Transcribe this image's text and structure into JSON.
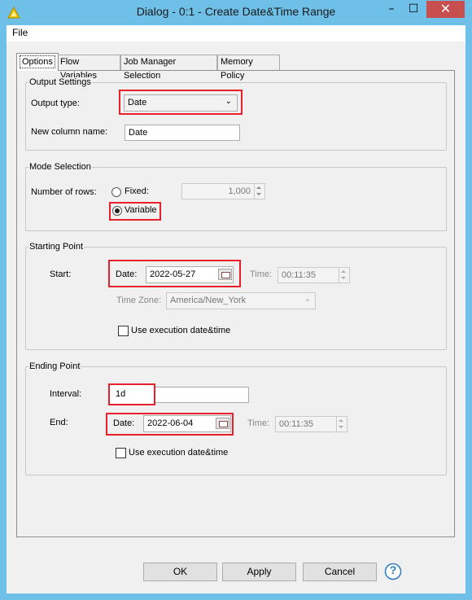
{
  "window": {
    "title": "Dialog - 0:1 - Create Date&Time Range",
    "minimize": "–",
    "maximize": "☐",
    "close": "✕"
  },
  "menu": {
    "file": "File"
  },
  "tabs": [
    {
      "label": "Options"
    },
    {
      "label": "Flow Variables"
    },
    {
      "label": "Job Manager Selection"
    },
    {
      "label": "Memory Policy"
    }
  ],
  "output_settings": {
    "title": "Output Settings",
    "output_type_label": "Output type:",
    "output_type_value": "Date",
    "column_name_label": "New column name:",
    "column_name_value": "Date"
  },
  "mode_selection": {
    "title": "Mode Selection",
    "rows_label": "Number of rows:",
    "fixed_label": "Fixed:",
    "fixed_value": "1,000",
    "variable_label": "Variable"
  },
  "starting_point": {
    "title": "Starting Point",
    "start_label": "Start:",
    "date_label": "Date:",
    "date_value": "2022-05-27",
    "time_label": "Time:",
    "time_value": "00:11:35",
    "timezone_label": "Time Zone:",
    "timezone_value": "America/New_York",
    "use_exec_label": "Use execution date&time"
  },
  "ending_point": {
    "title": "Ending Point",
    "interval_label": "Interval:",
    "interval_value": "1d",
    "end_label": "End:",
    "date_label": "Date:",
    "date_value": "2022-06-04",
    "time_label": "Time:",
    "time_value": "00:11:35",
    "use_exec_label": "Use execution date&time"
  },
  "buttons": {
    "ok": "OK",
    "apply": "Apply",
    "cancel": "Cancel",
    "help": "?"
  },
  "colors": {
    "titlebar": "#6ec0e8",
    "highlight": "#e8202a",
    "close": "#c7504f"
  }
}
